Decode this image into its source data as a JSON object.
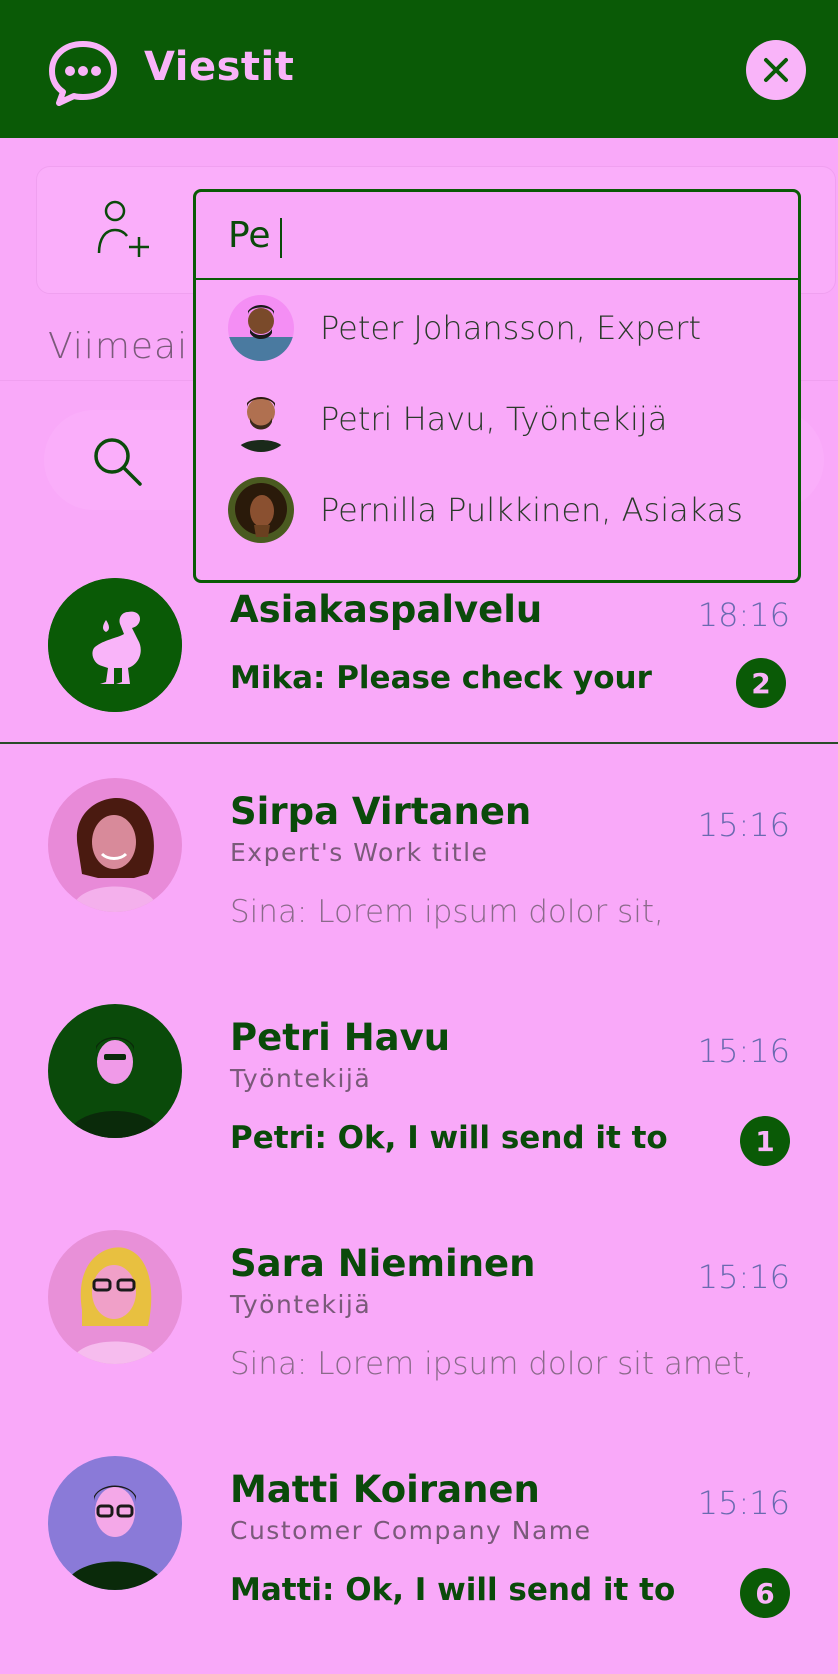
{
  "header": {
    "title": "Viestit",
    "close_icon": "close-icon",
    "logo_icon": "chat-bubble-icon"
  },
  "toolbar": {
    "add_user_icon": "add-user-icon",
    "section_label": "Viimeai",
    "search_icon": "search-icon"
  },
  "autocomplete": {
    "query": "Pe",
    "suggestions": [
      {
        "label": "Peter Johansson, Expert"
      },
      {
        "label": "Petri Havu, Työntekijä"
      },
      {
        "label": "Pernilla Pulkkinen, Asiakas"
      }
    ]
  },
  "conversations": [
    {
      "name": "Asiakaspalvelu",
      "subtitle": "",
      "preview": "Mika: Please check your",
      "time": "18:16",
      "unread": "2",
      "avatar_icon": "goose-logo-icon"
    },
    {
      "name": "Sirpa Virtanen",
      "subtitle": "Expert's Work title",
      "preview": "Sina: Lorem ipsum dolor sit,",
      "time": "15:16",
      "unread": ""
    },
    {
      "name": "Petri Havu",
      "subtitle": "Työntekijä",
      "preview": "Petri: Ok, I will send it to",
      "time": "15:16",
      "unread": "1"
    },
    {
      "name": "Sara Nieminen",
      "subtitle": "Työntekijä",
      "preview": "Sina: Lorem ipsum dolor sit amet,",
      "time": "15:16",
      "unread": ""
    },
    {
      "name": "Matti Koiranen",
      "subtitle": "Customer Company Name",
      "preview": "Matti: Ok, I will send it to",
      "time": "15:16",
      "unread": "6"
    }
  ],
  "colors": {
    "background": "#f9a9f9",
    "header": "#0a5a06",
    "accent": "#0a5a06"
  }
}
